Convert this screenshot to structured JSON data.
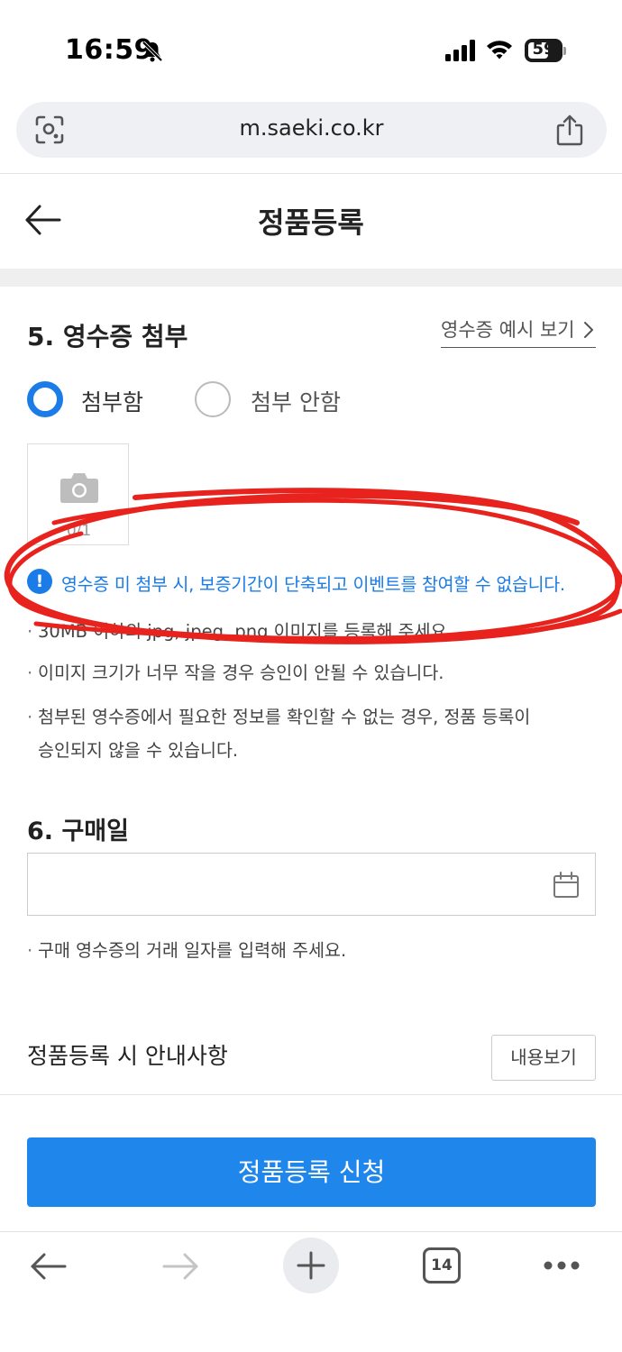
{
  "status_bar": {
    "time": "16:59",
    "battery": "59"
  },
  "browser": {
    "url": "m.saeki.co.kr"
  },
  "header": {
    "title": "정품등록"
  },
  "section5": {
    "title": "5. 영수증 첨부",
    "example_link": "영수증 예시 보기",
    "radio_attach": "첨부함",
    "radio_no_attach": "첨부 안함",
    "selected": "첨부함",
    "photo_count": "0/1",
    "warning": "영수증 미 첨부 시, 보증기간이 단축되고 이벤트를 참여할 수 없습니다.",
    "notes": [
      "30MB 이하의 jpg, jpeg, png 이미지를 등록해 주세요.",
      "이미지 크기가 너무 작을 경우 승인이 안될 수 있습니다.",
      "첨부된 영수증에서 필요한 정보를 확인할 수 없는 경우, 정품 등록이",
      "승인되지 않을 수 있습니다."
    ]
  },
  "section6": {
    "title": "6. 구매일",
    "date_value": "",
    "note": "구매 영수증의 거래 일자를 입력해 주세요."
  },
  "notice": {
    "title": "정품등록 시 안내사항",
    "view_button": "내용보기"
  },
  "submit": {
    "label": "정품등록 신청"
  },
  "toolbar": {
    "tab_count": "14"
  },
  "colors": {
    "accent": "#1f86ec",
    "warning_text": "#1b7ce8",
    "annotation": "#e8231e"
  },
  "icons": [
    "bell-muted-icon",
    "signal-icon",
    "wifi-icon",
    "battery-icon",
    "lens-icon",
    "share-icon",
    "back-arrow-icon",
    "chevron-right-icon",
    "camera-icon",
    "info-icon",
    "calendar-icon",
    "plus-icon",
    "forward-arrow-icon",
    "more-icon"
  ]
}
